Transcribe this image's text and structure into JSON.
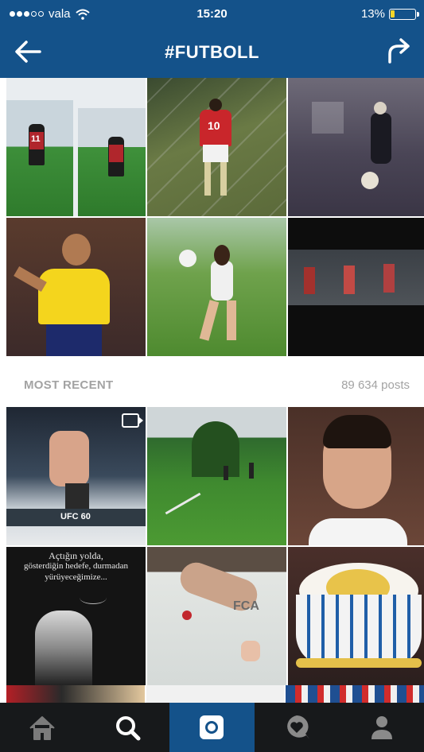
{
  "status_bar": {
    "carrier": "vala",
    "time": "15:20",
    "battery": "13%",
    "battery_level": 0.13
  },
  "nav": {
    "title": "#FUTBOLL",
    "back_icon": "arrow-left-icon",
    "share_icon": "share-arrow-icon"
  },
  "sections": {
    "recent_label": "MOST RECENT",
    "post_count": "89 634 posts"
  },
  "overlay_text": {
    "quote_line1": "Açtığın yolda,",
    "quote_line2": "gösterdiğin hedefe, durmadan",
    "quote_line3": "yürüyeceğimize...",
    "ufc_label": "UFC 60",
    "jersey_number": "10",
    "jersey_number_2": "11",
    "cake_letters": "FCA"
  },
  "tabs": [
    {
      "name": "home",
      "icon": "home-icon"
    },
    {
      "name": "explore",
      "icon": "search-icon"
    },
    {
      "name": "camera",
      "icon": "camera-icon",
      "active": true
    },
    {
      "name": "activity",
      "icon": "speech-heart-icon"
    },
    {
      "name": "profile",
      "icon": "person-icon"
    }
  ],
  "colors": {
    "header": "#14528a",
    "tabbar": "#17191b",
    "muted_text": "#a3a3a3"
  }
}
